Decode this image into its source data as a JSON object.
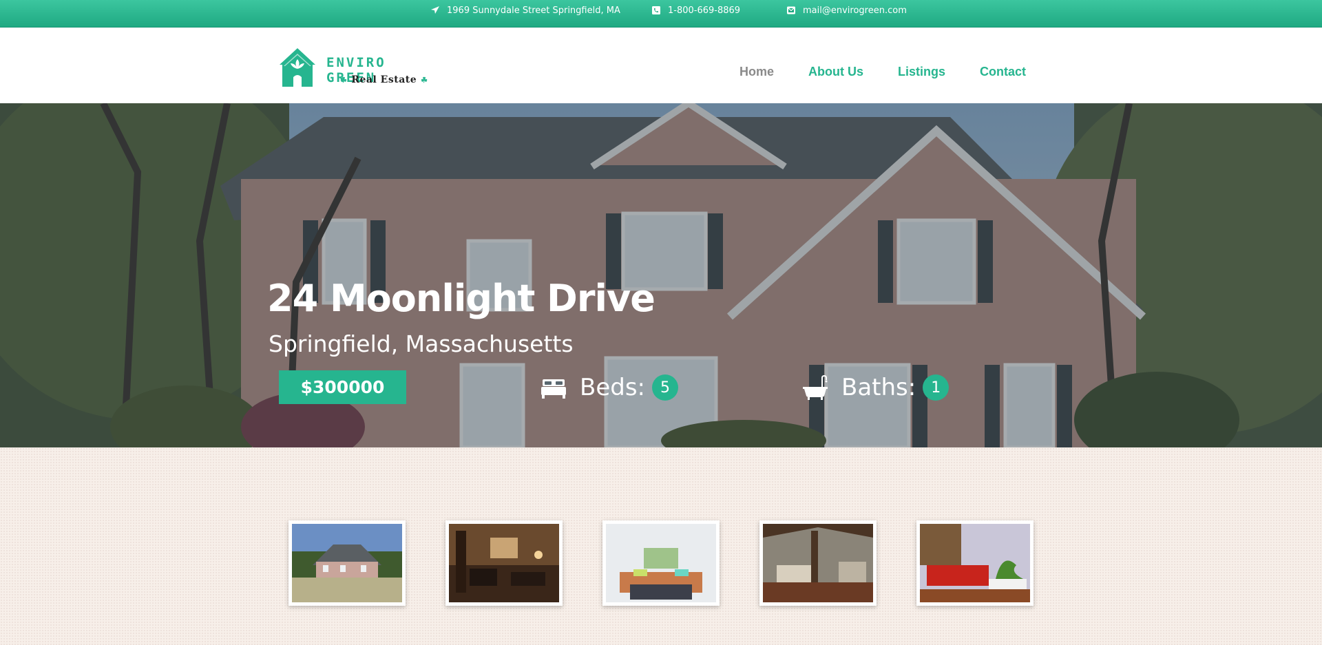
{
  "topbar": {
    "address": "1969 Sunnydale Street Springfield, MA",
    "phone": "1-800-669-8869",
    "email": "mail@envirogreen.com"
  },
  "brand": {
    "name": "ENVIRO GREEN",
    "tagline": "Real Estate",
    "logo_icon": "house-leaf-icon"
  },
  "nav": {
    "items": [
      {
        "label": "Home",
        "active": true
      },
      {
        "label": "About Us",
        "active": false
      },
      {
        "label": "Listings",
        "active": false
      },
      {
        "label": "Contact",
        "active": false
      }
    ]
  },
  "listing": {
    "title": "24 Moonlight Drive",
    "location": "Springfield, Massachusetts",
    "price": "$300000",
    "beds_label": "Beds:",
    "beds": "5",
    "baths_label": "Baths:",
    "baths": "1"
  },
  "gallery": {
    "thumbnails": [
      {
        "subject": "house-exterior"
      },
      {
        "subject": "living-room-dark"
      },
      {
        "subject": "living-room-bright"
      },
      {
        "subject": "great-room-wood-beams"
      },
      {
        "subject": "living-room-red-sofa"
      }
    ]
  },
  "colors": {
    "accent": "#26b58f",
    "nav_active": "#8a8a8a",
    "topbar": "#1fa982",
    "page_bg": "#f7efe9"
  }
}
